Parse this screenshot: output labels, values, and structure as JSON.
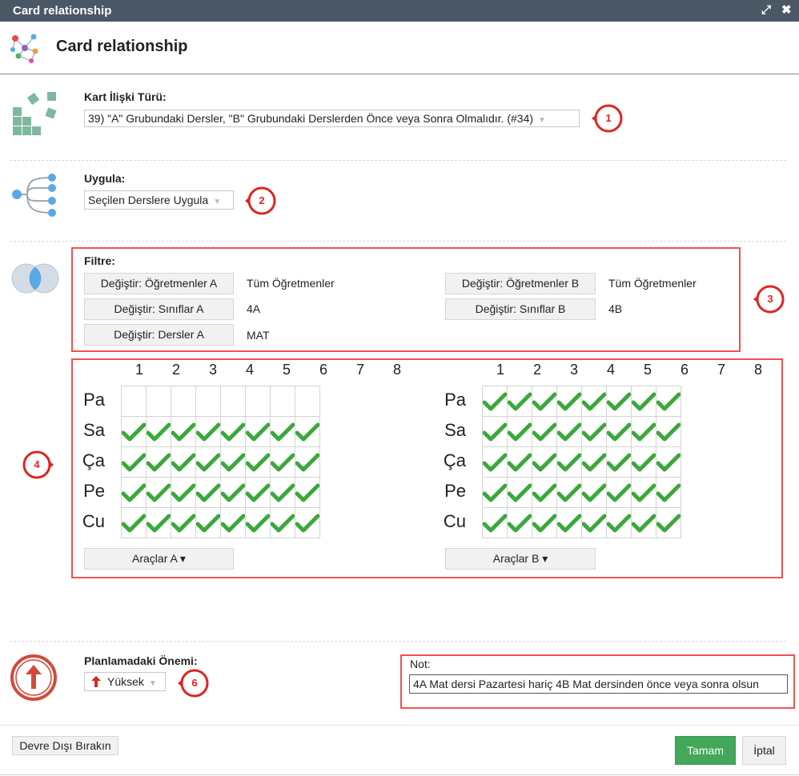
{
  "window": {
    "title": "Card relationship",
    "expand_icon": "⤢",
    "close_icon": "✖"
  },
  "header": {
    "title": "Card relationship"
  },
  "type_section": {
    "label": "Kart İlişki Türü:",
    "value": "39) \"A\" Grubundaki Dersler, \"B\" Grubundaki Derslerden Önce veya Sonra Olmalıdır. (#34)"
  },
  "apply_section": {
    "label": "Uygula:",
    "value": "Seçilen Derslere Uygula"
  },
  "filter_section": {
    "label": "Filtre:",
    "a": [
      {
        "button": "Değiştir: Öğretmenler A",
        "value": "Tüm Öğretmenler"
      },
      {
        "button": "Değiştir: Sınıflar A",
        "value": "4A"
      },
      {
        "button": "Değiştir: Dersler A",
        "value": "MAT"
      }
    ],
    "b": [
      {
        "button": "Değiştir: Öğretmenler B",
        "value": "Tüm Öğretmenler"
      },
      {
        "button": "Değiştir: Sınıflar B",
        "value": "4B"
      }
    ]
  },
  "grids": {
    "periods": [
      "1",
      "2",
      "3",
      "4",
      "5",
      "6",
      "7",
      "8"
    ],
    "days": [
      "Pa",
      "Sa",
      "Ça",
      "Pe",
      "Cu"
    ],
    "a": {
      "checked": [
        [
          false,
          false,
          false,
          false,
          false,
          false,
          false,
          false
        ],
        [
          true,
          true,
          true,
          true,
          true,
          true,
          true,
          true
        ],
        [
          true,
          true,
          true,
          true,
          true,
          true,
          true,
          true
        ],
        [
          true,
          true,
          true,
          true,
          true,
          true,
          true,
          true
        ],
        [
          true,
          true,
          true,
          true,
          true,
          true,
          true,
          true
        ]
      ],
      "tools_label": "Araçlar A ▾"
    },
    "b": {
      "checked": [
        [
          true,
          true,
          true,
          true,
          true,
          true,
          true,
          true
        ],
        [
          true,
          true,
          true,
          true,
          true,
          true,
          true,
          true
        ],
        [
          true,
          true,
          true,
          true,
          true,
          true,
          true,
          true
        ],
        [
          true,
          true,
          true,
          true,
          true,
          true,
          true,
          true
        ],
        [
          true,
          true,
          true,
          true,
          true,
          true,
          true,
          true
        ]
      ],
      "tools_label": "Araçlar B ▾"
    }
  },
  "importance_section": {
    "label": "Planlamadaki Önemi:",
    "value": "Yüksek",
    "icon": "red-up-arrow-icon"
  },
  "note_section": {
    "label": "Not:",
    "value": "4A Mat dersi Pazartesi hariç 4B Mat dersinden önce veya sonra olsun"
  },
  "callouts": [
    "1",
    "2",
    "3",
    "4",
    "6"
  ],
  "footer": {
    "disable_button": "Devre Dışı Bırakın",
    "ok_button": "Tamam",
    "cancel_button": "İptal"
  },
  "colors": {
    "accent_red": "#e0241f",
    "ok_green": "#43a85a",
    "check_green": "#3aa83a",
    "titlebar": "#4a5866"
  }
}
